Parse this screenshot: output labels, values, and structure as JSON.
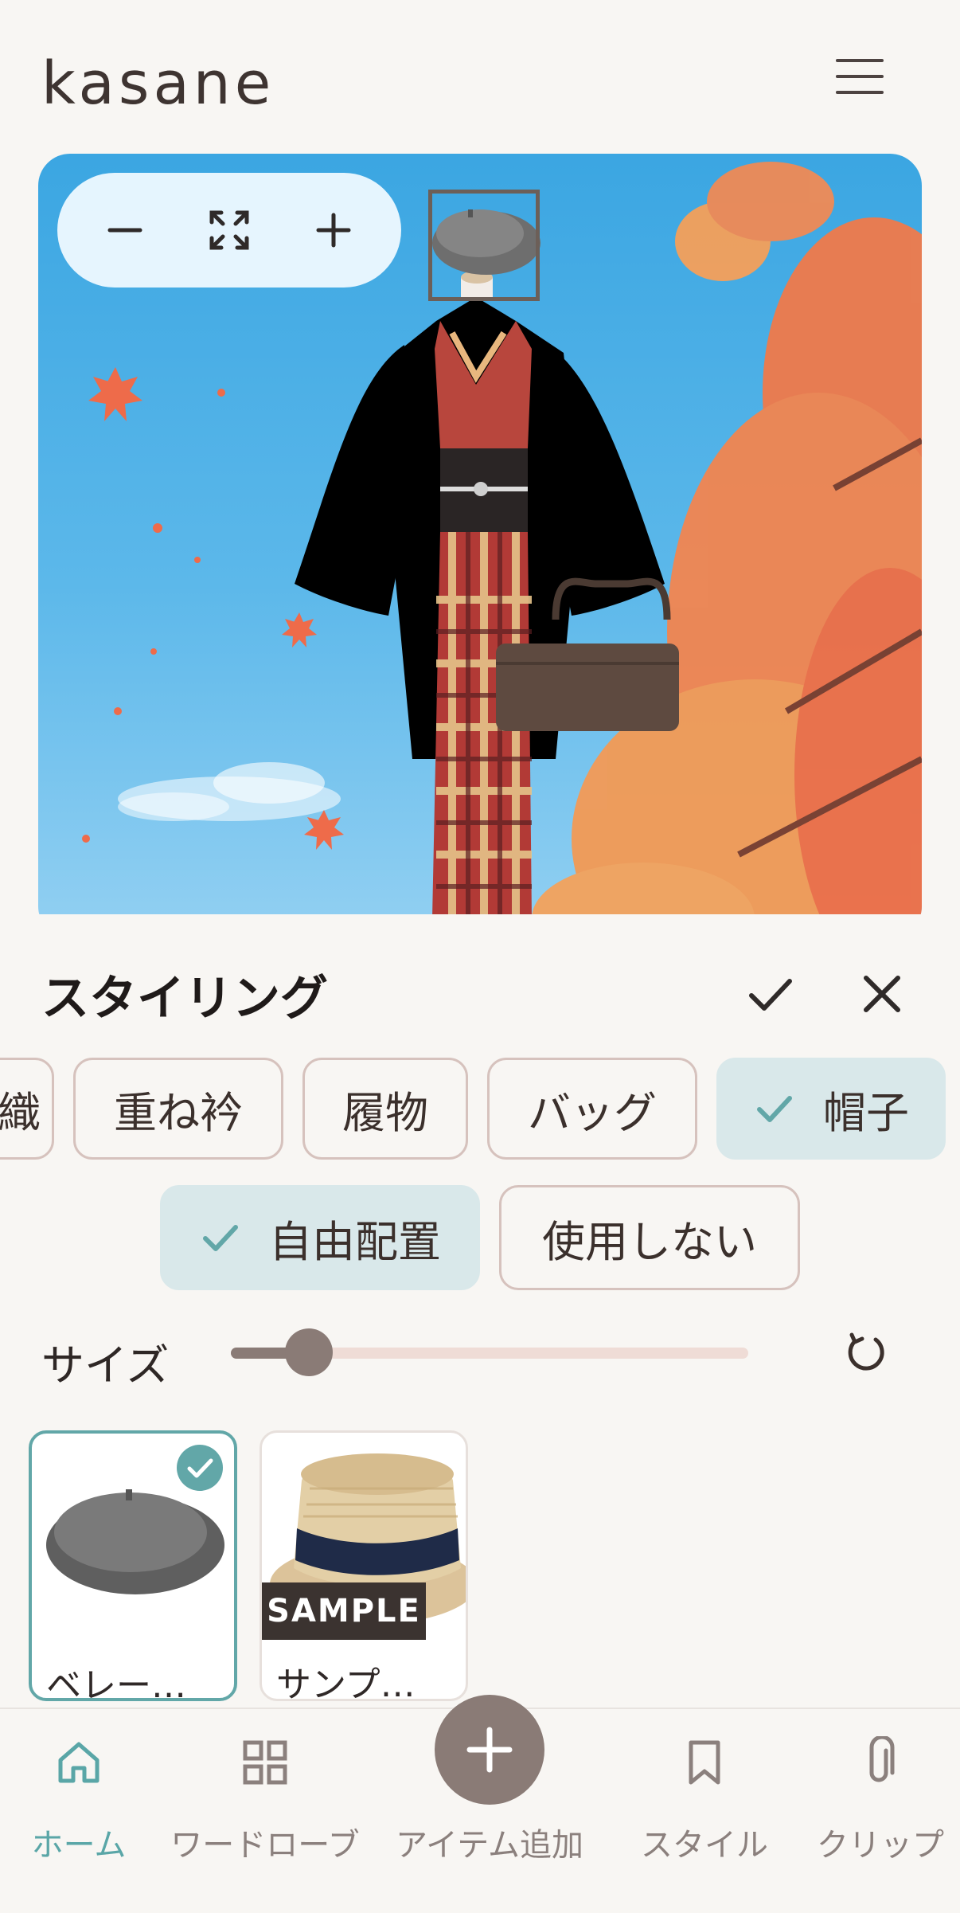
{
  "app": {
    "title": "kasane"
  },
  "zoom_controls": {
    "zoom_out": "−",
    "zoom_in": "+"
  },
  "sheet": {
    "title": "スタイリング",
    "categories": [
      {
        "label": "織",
        "selected": false
      },
      {
        "label": "重ね衿",
        "selected": false
      },
      {
        "label": "履物",
        "selected": false
      },
      {
        "label": "バッグ",
        "selected": false
      },
      {
        "label": "帽子",
        "selected": true
      }
    ],
    "placement": [
      {
        "label": "自由配置",
        "selected": true
      },
      {
        "label": "使用しない",
        "selected": false
      }
    ],
    "size": {
      "label": "サイズ",
      "value_fraction": 0.15
    },
    "items": [
      {
        "label": "ベレー…",
        "selected": true
      },
      {
        "label": "サンプ…",
        "tag": "SAMPLE",
        "selected": false
      }
    ]
  },
  "nav": [
    {
      "label": "ホーム",
      "icon": "home-icon",
      "active": true
    },
    {
      "label": "ワードローブ",
      "icon": "grid-icon",
      "active": false
    },
    {
      "label": "アイテム追加",
      "icon": "plus-icon",
      "active": false
    },
    {
      "label": "スタイル",
      "icon": "bookmark-icon",
      "active": false
    },
    {
      "label": "クリップ",
      "icon": "paperclip-icon",
      "active": false
    }
  ],
  "colors": {
    "accent": "#62a7a8",
    "primary": "#8a7b76",
    "chip_selected": "#d9e8ea",
    "background": "#f8f6f3"
  }
}
